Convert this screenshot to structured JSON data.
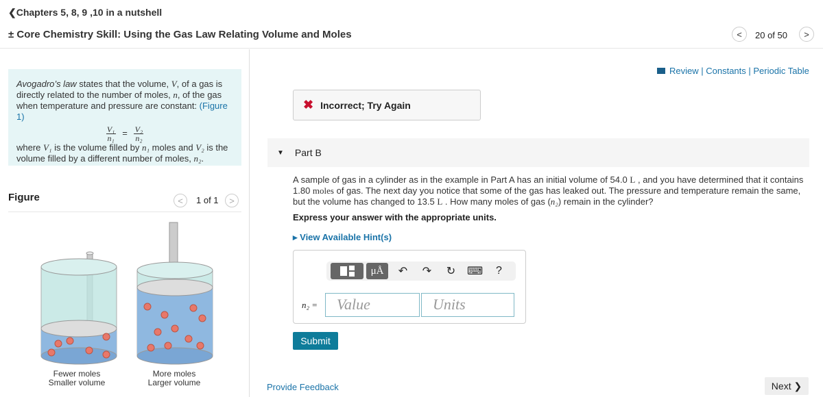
{
  "header": {
    "back_label": "❮Chapters 5, 8, 9 ,10 in a nutshell",
    "title": "± Core Chemistry Skill: Using the Gas Law Relating Volume and Moles",
    "nav_prev": "<",
    "nav_count": "20 of 50",
    "nav_next": ">"
  },
  "intro": {
    "term": "Avogadro’s law",
    "text1": " states that the volume, ",
    "V": "V",
    "text2": ", of a gas is directly related to the number of moles, ",
    "n": "n",
    "text3": ", of the gas when temperature and pressure are constant: ",
    "figure_link": "(Figure 1)",
    "eq_V1": "V₁",
    "eq_n1": "n₁",
    "eq_eq": "=",
    "eq_V2": "V₂",
    "eq_n2": "n₂",
    "w1": "where ",
    "w2": " is the volume filled by ",
    "w3": " moles and ",
    "w4": " is the volume filled by a different number of moles, ",
    "w5": "."
  },
  "figure": {
    "label": "Figure",
    "prev": "<",
    "count": "1 of 1",
    "next": ">",
    "caption_left": [
      "Fewer moles",
      "Smaller volume"
    ],
    "caption_right": [
      "More moles",
      "Larger volume"
    ]
  },
  "resources": {
    "icon": "book-icon",
    "review": "Review",
    "constants": "Constants",
    "periodic": "Periodic Table",
    "sep": " | "
  },
  "feedback": {
    "icon": "✖",
    "text": "Incorrect; Try Again"
  },
  "part": {
    "toggle": "▼",
    "label": "Part B"
  },
  "question": {
    "t1": "A sample of gas in a cylinder as in the example in Part A has an initial volume of 54.0 ",
    "L": "L",
    "t2": " , and you have determined that it contains 1.80 ",
    "moles": "moles",
    "t3": " of gas. The next day you notice that some of the gas has leaked out. The pressure and temperature remain the same, but the volume has changed to 13.5 ",
    "L2": "L",
    "t4": " . How many moles of gas (",
    "n2": "n₂",
    "t5": ") remain in the cylinder?"
  },
  "express": "Express your answer with the appropriate units.",
  "hint": "▸  View Available Hint(s)",
  "answer": {
    "tool_template": "templates-icon",
    "tool_units": "μÅ",
    "undo": "↶",
    "redo": "↷",
    "reset": "↻",
    "keyboard": "⌨",
    "help": "?",
    "var_label": "n₂ =",
    "value_placeholder": "Value",
    "units_placeholder": "Units"
  },
  "submit": "Submit",
  "provide_feedback": "Provide Feedback",
  "next": "Next ❯"
}
